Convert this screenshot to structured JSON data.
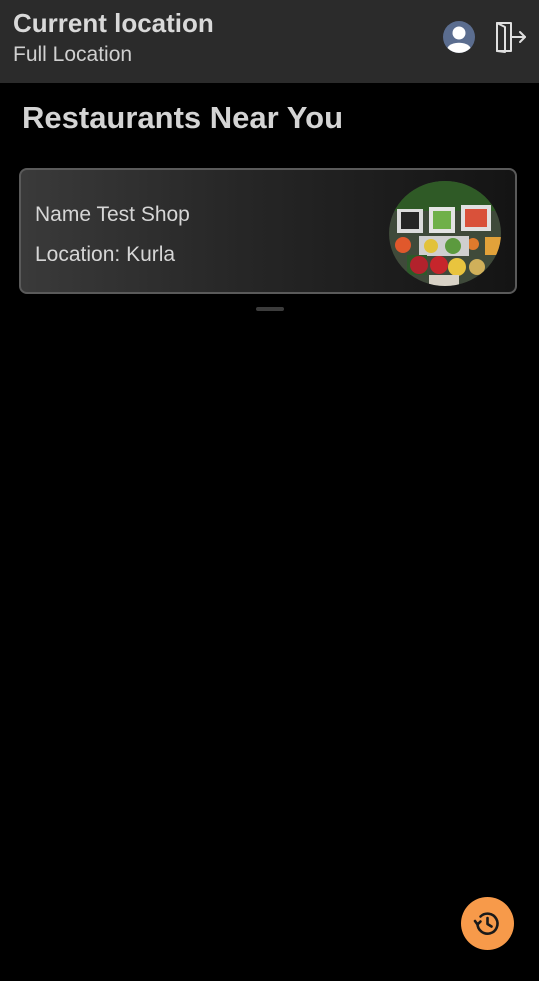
{
  "app_bar": {
    "title": "Current location",
    "subtitle": "Full Location",
    "icons": [
      "avatar-icon",
      "logout-icon"
    ]
  },
  "section": {
    "title": "Restaurants Near You"
  },
  "restaurants": [
    {
      "name": "Name Test Shop",
      "location": "Location: Kurla",
      "image": "food-platter-icon"
    }
  ],
  "fab": {
    "icon": "history-icon",
    "color": "#f79a4a"
  },
  "colors": {
    "app_bar_bg": "#2b2b2b",
    "page_bg": "#000000",
    "accent": "#f79a4a"
  }
}
